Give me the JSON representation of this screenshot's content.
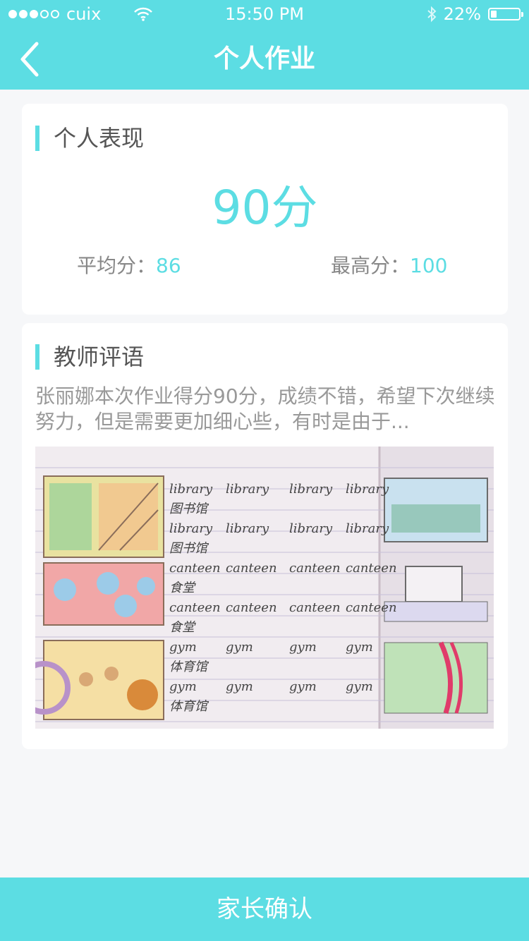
{
  "status_bar": {
    "carrier": "cuix",
    "time": "15:50 PM",
    "battery_text": "22%",
    "battery_level": 0.22,
    "signal_icon": "signal-dots-icon",
    "wifi_icon": "wifi-icon",
    "bluetooth_icon": "bluetooth-icon"
  },
  "nav": {
    "title": "个人作业",
    "back_icon": "chevron-left-icon"
  },
  "performance": {
    "section_title": "个人表现",
    "score": "90分",
    "average_label": "平均分：",
    "average_value": "86",
    "max_label": "最高分：",
    "max_value": "100"
  },
  "comment": {
    "section_title": "教师评语",
    "text": "张丽娜本次作业得分90分，成绩不错，希望下次继续努力，但是需要更加细心些，有时是由于...",
    "image_rows": [
      [
        "library",
        "library",
        "library",
        "library"
      ],
      [
        "图书馆"
      ],
      [
        "library",
        "library",
        "library",
        "library"
      ],
      [
        "图书馆"
      ],
      [
        "canteen",
        "canteen",
        "canteen",
        "canteen"
      ],
      [
        "食堂"
      ],
      [
        "canteen",
        "canteen",
        "canteen",
        "canteen"
      ],
      [
        "食堂"
      ],
      [
        "gym",
        "gym",
        "gym",
        "gym"
      ],
      [
        "体育馆"
      ],
      [
        "gym",
        "gym",
        "gym",
        "gym"
      ],
      [
        "体育馆"
      ]
    ]
  },
  "footer": {
    "confirm_label": "家长确认"
  },
  "colors": {
    "accent": "#5cdde3",
    "background": "#f6f7f9",
    "card": "#ffffff",
    "title_text": "#555555",
    "muted_text": "#888888",
    "comment_text": "#999999"
  }
}
